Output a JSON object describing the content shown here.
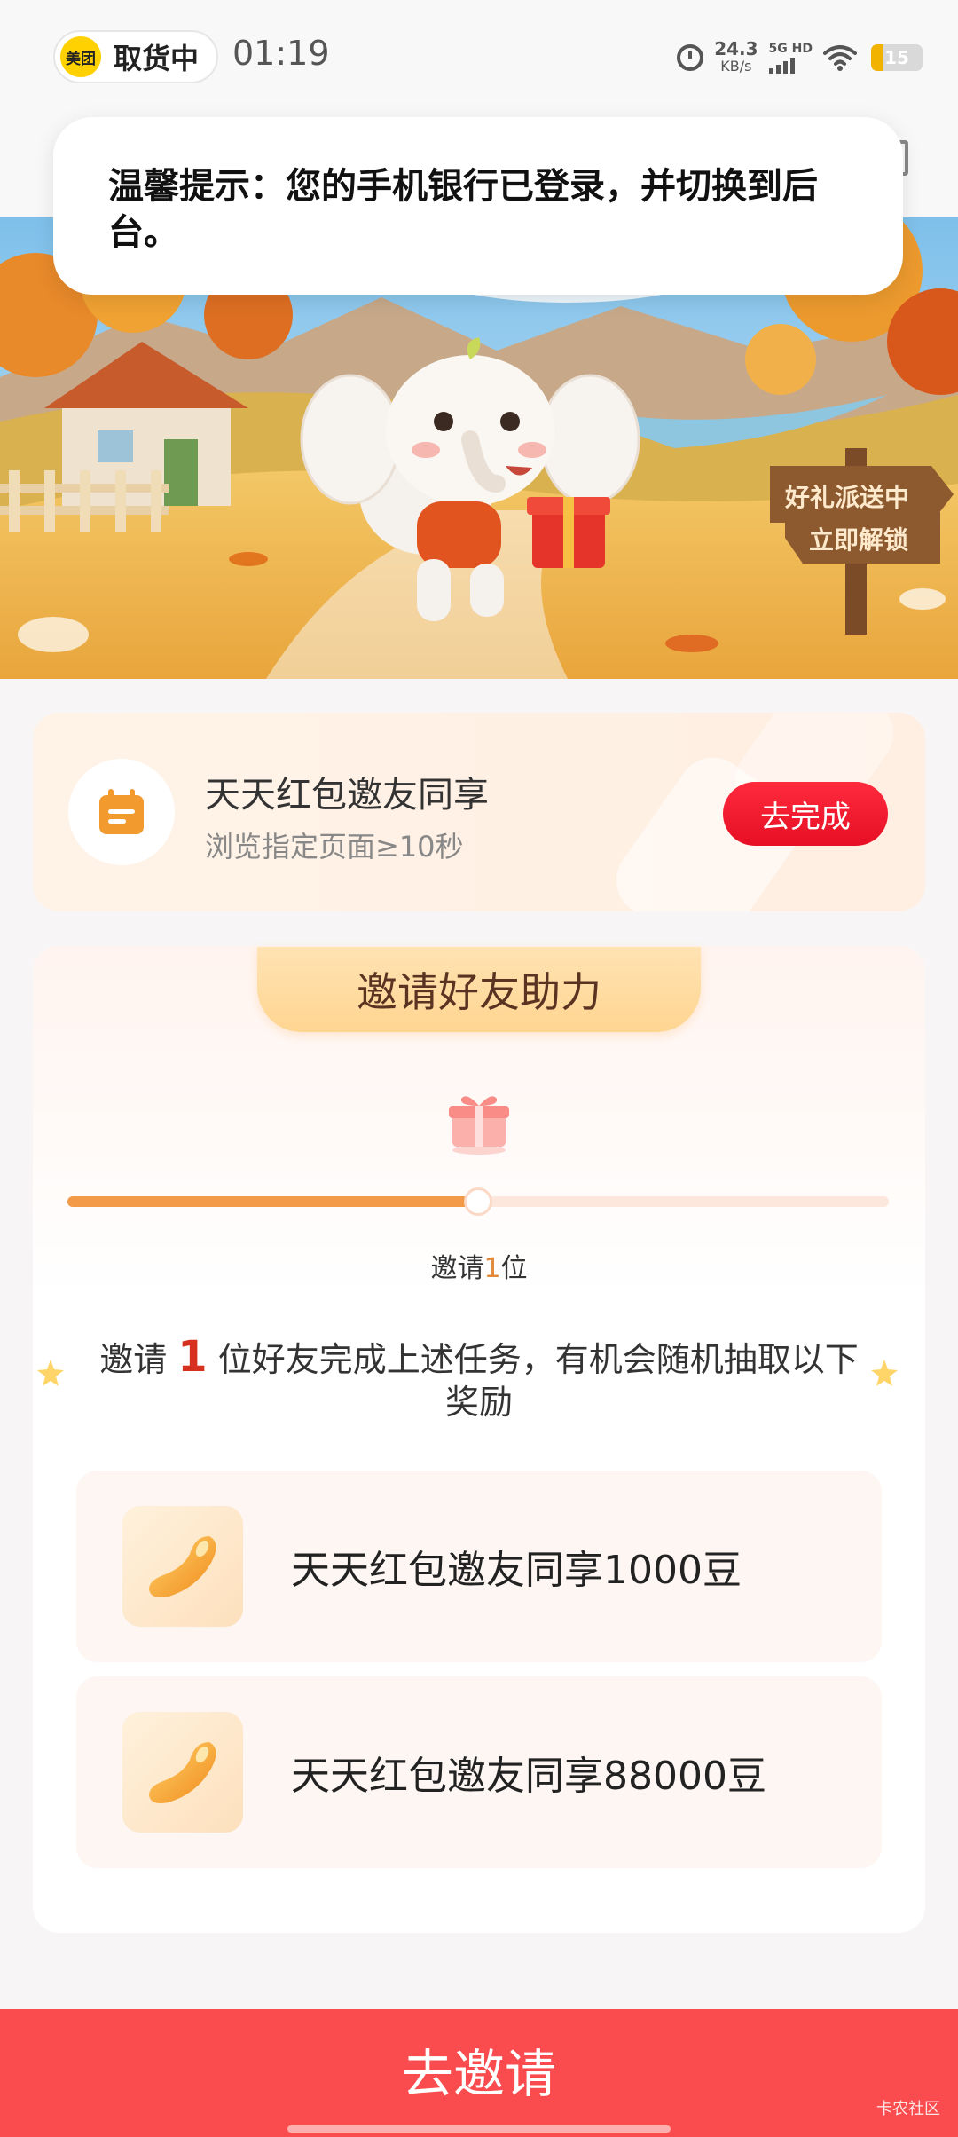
{
  "status_bar": {
    "app_pill_logo": "美团",
    "app_pill_text": "取货中",
    "time": "01:19",
    "net_speed_value": "24.3",
    "net_speed_unit": "KB/s",
    "network_label": "5G HD",
    "battery_level": "15"
  },
  "toast": {
    "text": "温馨提示：您的手机银行已登录，并切换到后台。"
  },
  "banner": {
    "sign_line1": "好礼派送中",
    "sign_line2": "立即解锁"
  },
  "task": {
    "title": "天天红包邀友同享",
    "subtitle": "浏览指定页面≥10秒",
    "button_label": "去完成"
  },
  "invite": {
    "header": "邀请好友助力",
    "progress": 0.5,
    "count_prefix": "邀请",
    "count_number": "1",
    "count_suffix": "位",
    "desc_prefix": "邀请",
    "desc_number": "1",
    "desc_suffix": "位好友完成上述任务，有机会随机抽取以下奖励"
  },
  "rewards": [
    {
      "label": "天天红包邀友同享1000豆",
      "icon": "bean-icon"
    },
    {
      "label": "天天红包邀友同享88000豆",
      "icon": "bean-icon"
    }
  ],
  "bottom_button": {
    "label": "去邀请"
  },
  "watermark": "卡农社区",
  "colors": {
    "primary_red": "#fa4c4e",
    "button_red": "#e60f24",
    "progress_orange": "#f29a47",
    "highlight_red": "#d8301f"
  }
}
